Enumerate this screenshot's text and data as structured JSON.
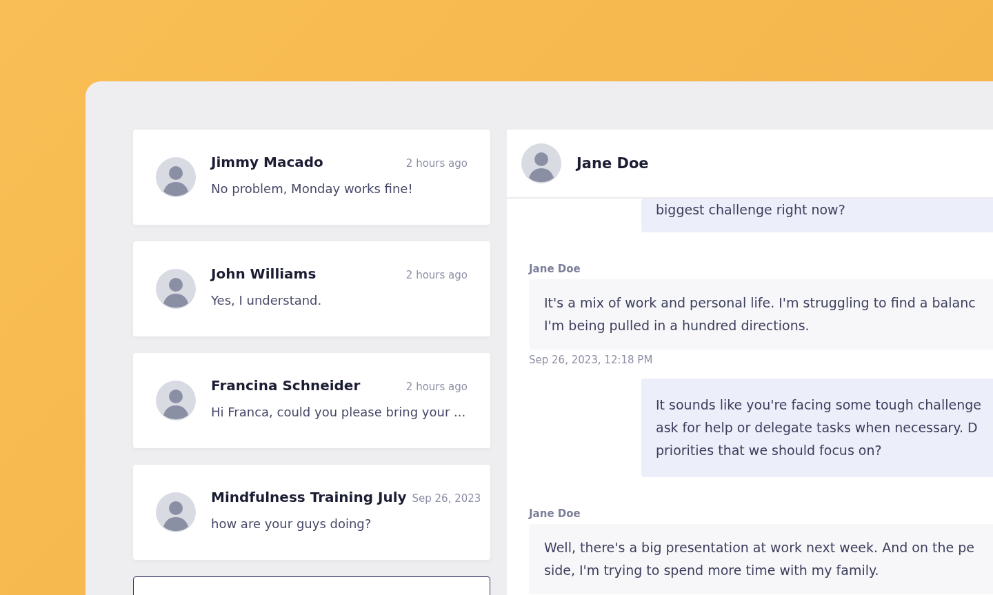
{
  "conversations": [
    {
      "name": "Jimmy Macado",
      "time": "2 hours ago",
      "preview": "No problem, Monday works fine!"
    },
    {
      "name": "John Williams",
      "time": "2 hours ago",
      "preview": "Yes, I understand."
    },
    {
      "name": "Francina Schneider",
      "time": "2 hours ago",
      "preview": "Hi Franca, could you please bring your ..."
    },
    {
      "name": "Mindfulness Training July",
      "time": "Sep 26, 2023",
      "preview": "how are your guys doing?"
    }
  ],
  "chat": {
    "title": "Jane Doe",
    "messages": [
      {
        "kind": "outgoing",
        "lines": [
          "biggest challenge right now?"
        ]
      },
      {
        "kind": "incoming",
        "sender": "Jane Doe",
        "lines": [
          "It's a mix of work and personal life. I'm struggling to find a balanc",
          "I'm being pulled in a hundred directions."
        ],
        "timestamp": "Sep 26, 2023, 12:18 PM"
      },
      {
        "kind": "outgoing",
        "lines": [
          "It sounds like you're facing some tough challenge",
          "ask for help or delegate tasks when necessary. D",
          "priorities that we should focus on?"
        ]
      },
      {
        "kind": "incoming",
        "sender": "Jane Doe",
        "lines": [
          "Well, there's a big presentation at work next week. And on the pe",
          "side, I'm trying to spend more time with my family."
        ]
      }
    ]
  }
}
